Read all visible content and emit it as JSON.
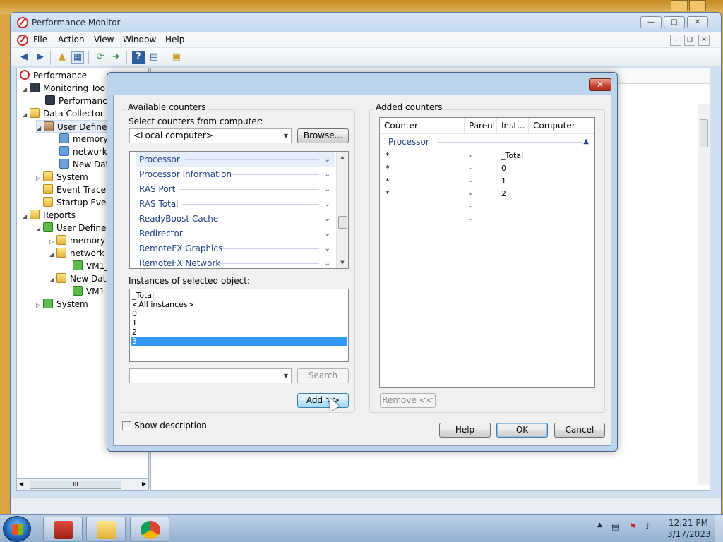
{
  "window": {
    "title": "Performance Monitor",
    "menu": [
      "File",
      "Action",
      "View",
      "Window",
      "Help"
    ]
  },
  "tree": {
    "items": [
      {
        "label": "Performance",
        "icon": "performance-icon"
      },
      {
        "label": "Monitoring Too",
        "icon": "folder-icon"
      },
      {
        "label": "Performance",
        "icon": "monitor-icon"
      },
      {
        "label": "Data Collector S",
        "icon": "folder-icon"
      },
      {
        "label": "User Defined",
        "icon": "user-folder-icon"
      },
      {
        "label": "memory",
        "icon": "data-collector-icon"
      },
      {
        "label": "network",
        "icon": "data-collector-icon"
      },
      {
        "label": "New Data",
        "icon": "data-collector-icon"
      },
      {
        "label": "System",
        "icon": "folder-icon"
      },
      {
        "label": "Event Trace S",
        "icon": "folder-icon"
      },
      {
        "label": "Startup Even",
        "icon": "folder-icon"
      },
      {
        "label": "Reports",
        "icon": "reports-folder-icon"
      },
      {
        "label": "User Defined",
        "icon": "reports-folder-icon"
      },
      {
        "label": "memory",
        "icon": "reports-folder-icon"
      },
      {
        "label": "network",
        "icon": "reports-folder-icon"
      },
      {
        "label": "VM1_",
        "icon": "report-icon"
      },
      {
        "label": "New Data",
        "icon": "reports-folder-icon"
      },
      {
        "label": "VM1_",
        "icon": "report-icon"
      },
      {
        "label": "System",
        "icon": "reports-folder-icon"
      }
    ],
    "scroll_thumb": "III"
  },
  "dialog": {
    "available_counters_label": "Available counters",
    "select_from_label": "Select counters from computer:",
    "computer_value": "<Local computer>",
    "browse_label": "Browse...",
    "objects": [
      "Processor",
      "Processor Information",
      "RAS Port",
      "RAS Total",
      "ReadyBoost Cache",
      "Redirector",
      "RemoteFX Graphics",
      "RemoteFX Network"
    ],
    "instances_label": "Instances of selected object:",
    "instances": [
      "_Total",
      "<All instances>",
      "0",
      "1",
      "2",
      "3"
    ],
    "selected_instance": "3",
    "search_label": "Search",
    "search_value": "",
    "add_label": "Add >>",
    "added_counters_label": "Added counters",
    "columns": [
      "Counter",
      "Parent",
      "Inst...",
      "Computer"
    ],
    "group_name": "Processor",
    "rows": [
      {
        "counter": "*",
        "parent": "---",
        "instance": "_Total"
      },
      {
        "counter": "*",
        "parent": "---",
        "instance": "0"
      },
      {
        "counter": "*",
        "parent": "---",
        "instance": "1"
      },
      {
        "counter": "*",
        "parent": "---",
        "instance": "2"
      }
    ],
    "remove_label": "Remove <<",
    "show_description_label": "Show description",
    "help_label": "Help",
    "ok_label": "OK",
    "cancel_label": "Cancel"
  },
  "taskbar": {
    "time": "12:21 PM",
    "date": "3/17/2023"
  },
  "colors": {
    "selection": "#3399ff",
    "object_text": "#1e3f8a",
    "dialog_frame": "#bcd3ec"
  }
}
